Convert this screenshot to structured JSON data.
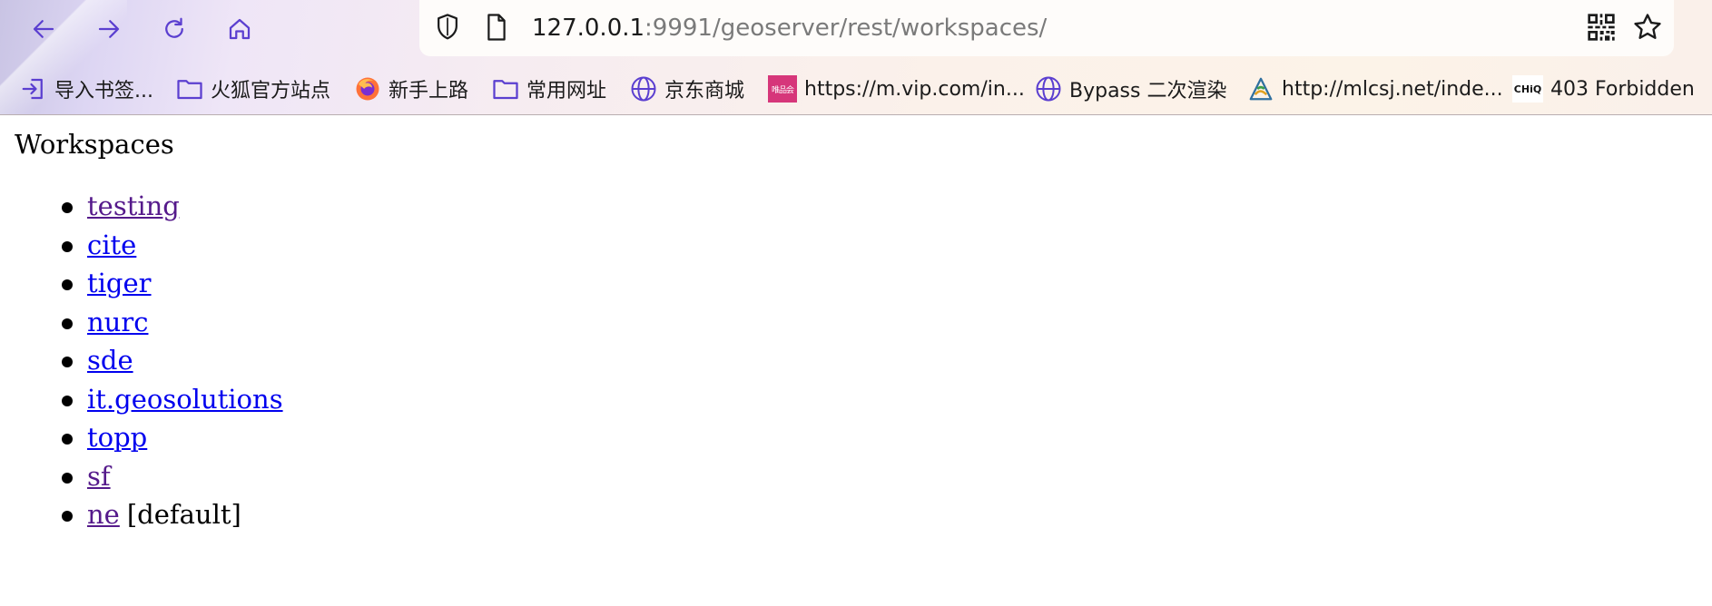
{
  "browser": {
    "url_host": "127.0.0.1",
    "url_rest": ":9991/geoserver/rest/workspaces/",
    "bookmarks": [
      {
        "label": "导入书签...",
        "icon": "import-icon"
      },
      {
        "label": "火狐官方站点",
        "icon": "folder-icon"
      },
      {
        "label": "新手上路",
        "icon": "firefox-icon"
      },
      {
        "label": "常用网址",
        "icon": "folder-icon"
      },
      {
        "label": "京东商城",
        "icon": "globe-icon"
      },
      {
        "label": "https://m.vip.com/in...",
        "icon": "vip-favicon"
      },
      {
        "label": "Bypass 二次渲染",
        "icon": "globe-icon"
      },
      {
        "label": "http://mlcsj.net/inde...",
        "icon": "mlcsj-favicon"
      },
      {
        "label": "403 Forbidden",
        "icon": "chiq-favicon"
      }
    ],
    "favicon_text": {
      "vip": "唯品会",
      "chiq": "CHiQ"
    }
  },
  "page": {
    "title": "Workspaces",
    "workspaces": [
      {
        "name": "testing",
        "visited": true,
        "suffix": ""
      },
      {
        "name": "cite",
        "visited": false,
        "suffix": ""
      },
      {
        "name": "tiger",
        "visited": false,
        "suffix": ""
      },
      {
        "name": "nurc",
        "visited": false,
        "suffix": ""
      },
      {
        "name": "sde",
        "visited": false,
        "suffix": ""
      },
      {
        "name": "it.geosolutions",
        "visited": false,
        "suffix": ""
      },
      {
        "name": "topp",
        "visited": false,
        "suffix": ""
      },
      {
        "name": "sf",
        "visited": true,
        "suffix": ""
      },
      {
        "name": "ne",
        "visited": true,
        "suffix": "[default]"
      }
    ]
  },
  "colors": {
    "link": "#0000ee",
    "visited_link": "#551a8b",
    "chrome_icon": "#5b3fd0"
  }
}
